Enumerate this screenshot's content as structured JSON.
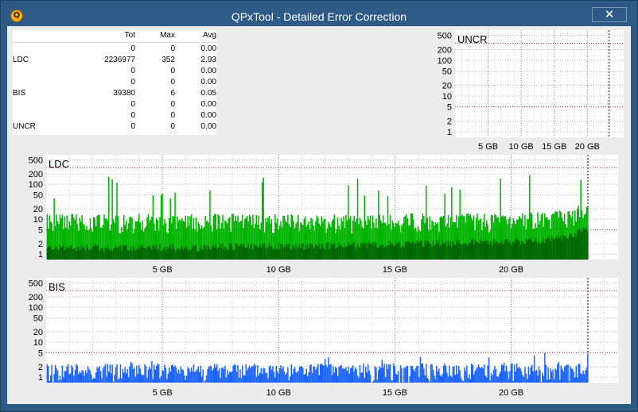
{
  "window": {
    "title": "QPxTool - Detailed Error Correction",
    "close_glyph": "✕"
  },
  "stats": {
    "headers": [
      "Tot",
      "Max",
      "Avg"
    ],
    "rows": [
      {
        "label": "",
        "tot": "0",
        "max": "0",
        "avg": "0.00"
      },
      {
        "label": "LDC",
        "tot": "2236977",
        "max": "352",
        "avg": "2.93"
      },
      {
        "label": "",
        "tot": "0",
        "max": "0",
        "avg": "0.00"
      },
      {
        "label": "",
        "tot": "0",
        "max": "0",
        "avg": "0.00"
      },
      {
        "label": "BIS",
        "tot": "39380",
        "max": "6",
        "avg": "0.05"
      },
      {
        "label": "",
        "tot": "0",
        "max": "0",
        "avg": "0.00"
      },
      {
        "label": "",
        "tot": "0",
        "max": "0",
        "avg": "0.00"
      },
      {
        "label": "UNCR",
        "tot": "0",
        "max": "0",
        "avg": "0.00"
      }
    ]
  },
  "chart_data": [
    {
      "id": "uncr",
      "type": "bar",
      "title": "UNCR",
      "scale": "log",
      "y_ticks": [
        "500",
        "200",
        "100",
        "50",
        "20",
        "10",
        "5",
        "2",
        "1"
      ],
      "x_ticks": [
        "5 GB",
        "10 GB",
        "15 GB",
        "20 GB"
      ],
      "x_tick_values": [
        5,
        10,
        15,
        20
      ],
      "xlim": [
        0,
        25.5
      ],
      "ylim": [
        0.7,
        700
      ],
      "end_marker_gb": 23.3,
      "threshold_lines": [
        5,
        300
      ],
      "series": []
    },
    {
      "id": "ldc",
      "type": "bar",
      "title": "LDC",
      "scale": "log",
      "y_ticks": [
        "500",
        "200",
        "100",
        "50",
        "20",
        "10",
        "5",
        "2",
        "1"
      ],
      "x_ticks": [
        "5 GB",
        "10 GB",
        "15 GB",
        "20 GB"
      ],
      "x_tick_values": [
        5,
        10,
        15,
        20
      ],
      "xlim": [
        0,
        24.6
      ],
      "ylim": [
        0.7,
        700
      ],
      "end_marker_gb": 23.3,
      "threshold_lines": [
        5,
        300
      ],
      "color": "#00b400",
      "dark_color": "#006400",
      "x": [
        0.5,
        1.5,
        2.5,
        3.5,
        4.5,
        5.5,
        6.5,
        7.5,
        8.5,
        9.5,
        10.5,
        11.5,
        12.5,
        13.5,
        14.5,
        15.5,
        16.5,
        17.5,
        18.5,
        19.5,
        20.5,
        21.5,
        22.5,
        23.2
      ],
      "typical": [
        12,
        12,
        11,
        11,
        12,
        11,
        11,
        12,
        11,
        11,
        12,
        11,
        11,
        11,
        12,
        12,
        12,
        12,
        12,
        12,
        13,
        13,
        16,
        24
      ],
      "base": [
        1.5,
        1.5,
        1.5,
        1.5,
        1.5,
        1.5,
        1.5,
        1.6,
        1.6,
        1.6,
        1.6,
        1.7,
        1.7,
        1.8,
        1.8,
        1.9,
        2,
        2,
        2.1,
        2.2,
        2.3,
        2.5,
        3,
        5
      ],
      "peaks": [
        75,
        60,
        200,
        80,
        70,
        90,
        90,
        50,
        180,
        120,
        90,
        90,
        160,
        80,
        60,
        130,
        90,
        120,
        130,
        150,
        200,
        130,
        150,
        90
      ]
    },
    {
      "id": "bis",
      "type": "bar",
      "title": "BIS",
      "scale": "log",
      "y_ticks": [
        "500",
        "200",
        "100",
        "50",
        "20",
        "10",
        "5",
        "2",
        "1"
      ],
      "x_ticks": [
        "5 GB",
        "10 GB",
        "15 GB",
        "20 GB"
      ],
      "x_tick_values": [
        5,
        10,
        15,
        20
      ],
      "xlim": [
        0,
        24.6
      ],
      "ylim": [
        0.7,
        700
      ],
      "end_marker_gb": 23.3,
      "threshold_lines": [
        5,
        300
      ],
      "color": "#1c64ff",
      "x": [
        0.5,
        1.5,
        2.5,
        3.5,
        4.5,
        5.5,
        6.5,
        7.5,
        8.5,
        9.5,
        10.5,
        11.5,
        12.5,
        13.5,
        14.5,
        15.5,
        16.5,
        17.5,
        18.5,
        19.5,
        20.5,
        21.5,
        22.5,
        23.2
      ],
      "typical": [
        2,
        2,
        2,
        2,
        2,
        2,
        2,
        2,
        2,
        2,
        2,
        2,
        2,
        2,
        2,
        2,
        2,
        2,
        2,
        2,
        2,
        2,
        2,
        2
      ],
      "peaks": [
        3,
        3,
        4,
        3,
        4,
        3,
        3,
        3,
        4,
        3,
        3,
        4,
        3,
        4,
        3,
        4,
        3,
        3,
        4,
        4,
        6,
        4,
        6,
        5
      ]
    }
  ]
}
